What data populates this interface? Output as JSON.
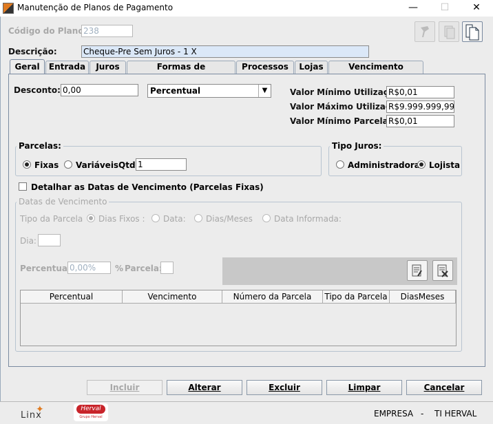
{
  "window": {
    "title": "Manutenção de Planos de Pagamento",
    "minimize": "—",
    "maximize": "☐",
    "close": "✕"
  },
  "header": {
    "codigo_label": "Código do Plano:",
    "codigo_value": "238",
    "descricao_label": "Descrição:",
    "descricao_value": "Cheque-Pre Sem Juros - 1 X"
  },
  "tabs": [
    "Geral",
    "Entrada",
    "Juros",
    "Formas de Recebimento",
    "Processos",
    "Lojas",
    "Vencimento Variavel"
  ],
  "geral": {
    "desconto_label": "Desconto:",
    "desconto_value": "0,00",
    "desconto_tipo": "Percentual",
    "valor_min_util_label": "Valor Mínimo Utilização:",
    "valor_min_util_value": "R$0,01",
    "valor_max_util_label": "Valor Máximo Utilização:",
    "valor_max_util_value": "R$9.999.999,99",
    "valor_min_parc_label": "Valor Mínimo Parcela:",
    "valor_min_parc_value": "R$0,01",
    "parcelas_title": "Parcelas:",
    "fixas_label": "Fixas",
    "variaveis_label": "Variáveis",
    "qtd_label": "Qtd",
    "qtd_value": "1",
    "tipo_juros_title": "Tipo Juros:",
    "administradora_label": "Administradora",
    "lojista_label": "Lojista",
    "detalhar_label": "Detalhar as Datas de Vencimento (Parcelas Fixas)",
    "datas_title": "Datas de Vencimento",
    "tipo_parcela_label": "Tipo da Parcela",
    "dias_fixos_label": "Dias Fixos :",
    "data_label": "Data:",
    "dias_meses_label": "Dias/Meses",
    "data_informada_label": "Data Informada:",
    "dia_label": "Dia:",
    "percentual_label": "Percentual:",
    "percentual_value": "0,00%",
    "pct_sign": "%",
    "parcela_label": "Parcela:",
    "table_headers": [
      "Percentual",
      "Vencimento",
      "Número da Parcela",
      "Tipo da Parcela",
      "DiasMeses"
    ]
  },
  "buttons": {
    "incluir": "Incluir",
    "alterar": "Alterar",
    "excluir": "Excluir",
    "limpar": "Limpar",
    "cancelar": "Cancelar"
  },
  "status": {
    "logo_linx": "Linx",
    "logo_herval": "Herval",
    "logo_herval_sub": "Grupo Herval",
    "empresa_label": "EMPRESA",
    "separator": "-",
    "empresa_value": "TI HERVAL"
  }
}
